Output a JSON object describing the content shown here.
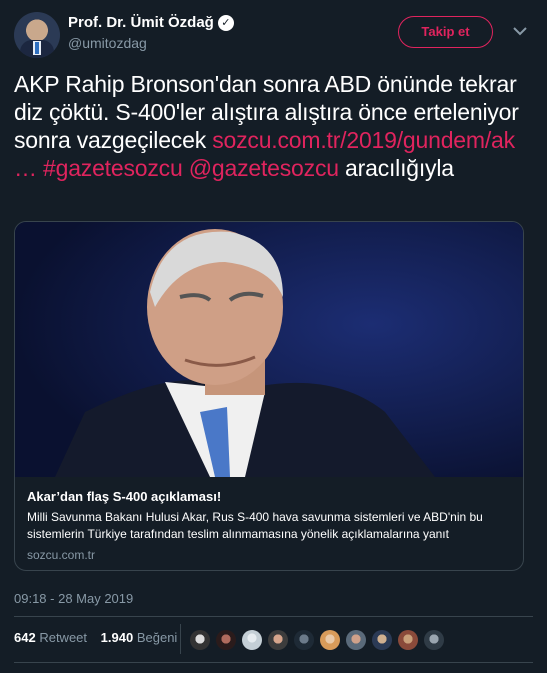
{
  "user": {
    "display_name": "Prof. Dr. Ümit Özdağ",
    "handle": "@umitozdag",
    "verified_icon": "verified-badge-icon"
  },
  "actions": {
    "follow_label": "Takip et",
    "more_icon": "chevron-down-icon"
  },
  "tweet": {
    "text": "AKP Rahip Bronson'dan sonra ABD önünde tekrar diz çöktü. S-400'ler alıştıra alıştıra önce erteleniyor sonra vazgeçilecek",
    "link": "sozcu.com.tr/2019/gundem/ak …",
    "hashtag": "#gazetesozcu",
    "mention": "@gazetesozcu",
    "via": "aracılığıyla"
  },
  "card": {
    "title": "Akar’dan flaş S-400 açıklaması!",
    "description": "Milli Savunma Bakanı Hulusi Akar, Rus S-400 hava savunma sistemleri ve ABD'nin bu sistemlerin Türkiye tarafından teslim alınmamasına yönelik açıklamalarına yanıt",
    "domain": "sozcu.com.tr"
  },
  "timestamp": "09:18 - 28 May 2019",
  "stats": {
    "retweets": "642",
    "retweets_label": "Retweet",
    "likes": "1.940",
    "likes_label": "Beğeni"
  },
  "colors": {
    "background": "#141d26",
    "accent": "#e0245e",
    "muted": "#8899a6",
    "border": "#38444d"
  }
}
